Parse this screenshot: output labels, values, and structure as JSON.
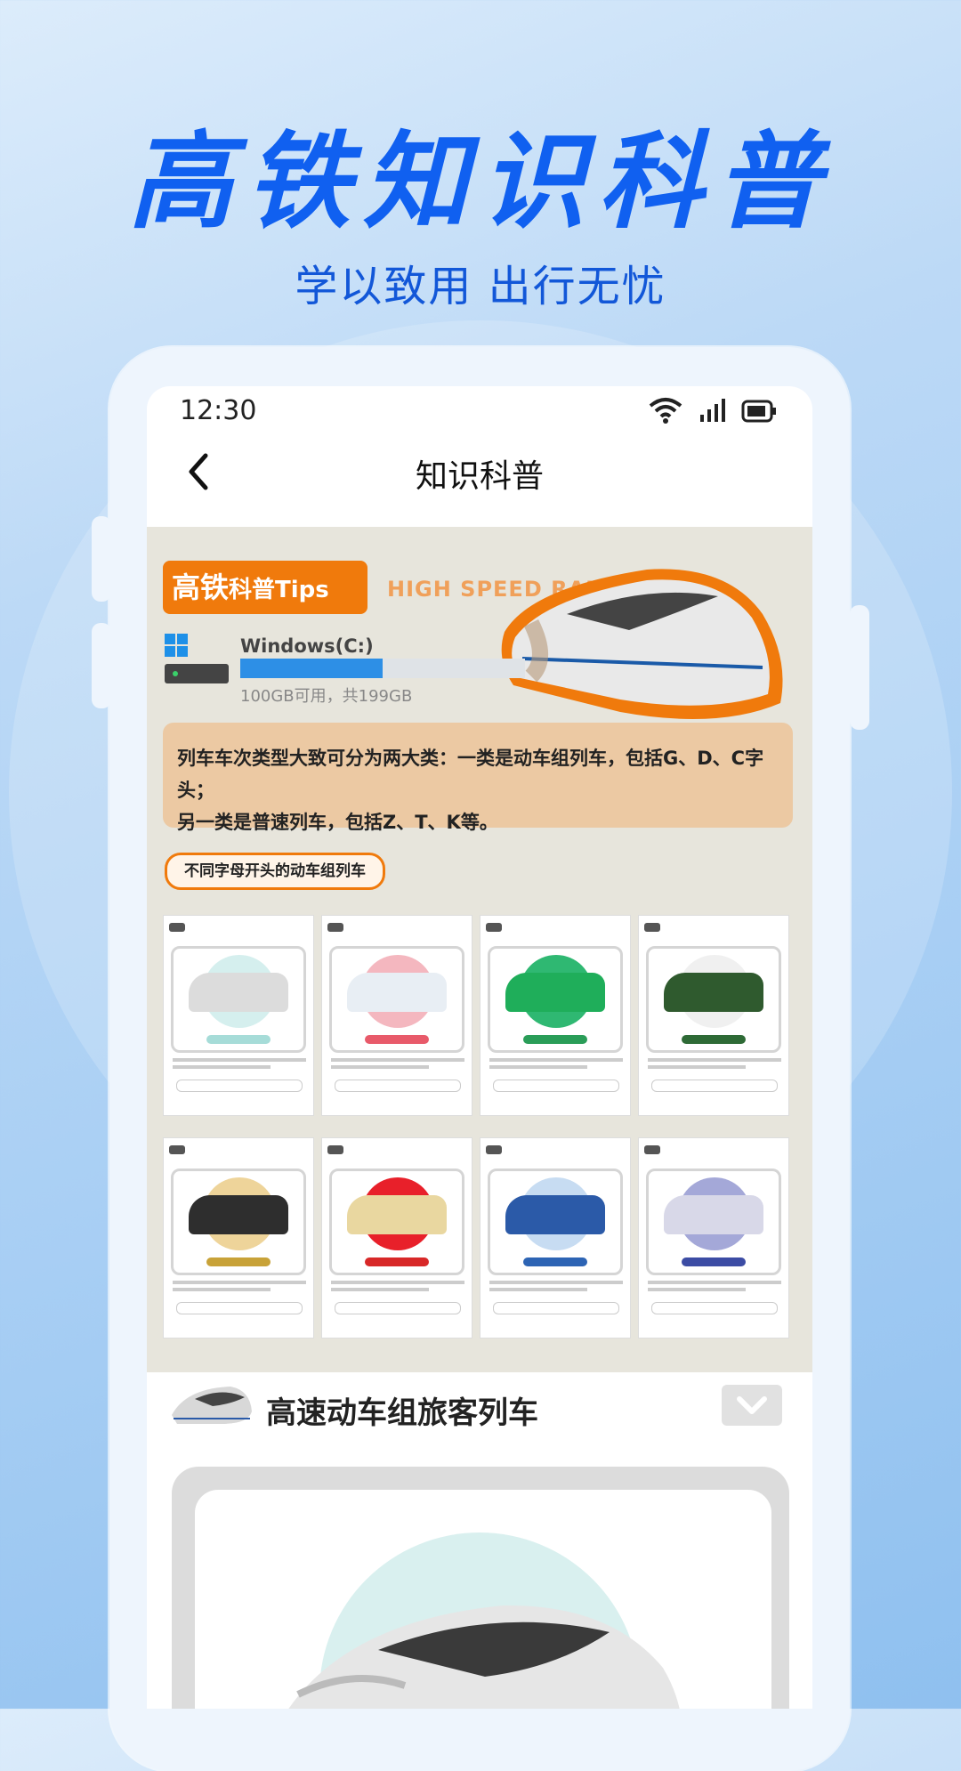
{
  "hero": {
    "title": "高铁知识科普",
    "subtitle": "学以致用 出行无忧"
  },
  "status_bar": {
    "time": "12:30",
    "icons": [
      "wifi-icon",
      "signal-icon",
      "battery-icon"
    ]
  },
  "nav": {
    "back_icon": "chevron-left-icon",
    "title": "知识科普"
  },
  "poster": {
    "tag": "高铁",
    "tag_suffix": "科普Tips",
    "header_en": "HIGH SPEED RAIL",
    "drive_label": "Windows(C:)",
    "drive_usage_fraction": 0.5,
    "drive_free": "100GB可用，共199GB",
    "info_line1": "列车车次类型大致可分为两大类：一类是动车组列车，包括G、D、C字头；",
    "info_line2": "另一类是普速列车，包括Z、T、K等。",
    "pill": "不同字母开头的动车组列车",
    "cards": [
      {
        "circle": "#d5efee",
        "train": "#dcdcdc",
        "label": "#a6dcd8"
      },
      {
        "circle": "#f4b7bf",
        "train": "#e8eef4",
        "label": "#e85a6a"
      },
      {
        "circle": "#2fb872",
        "train": "#1fae5a",
        "label": "#2a9d58"
      },
      {
        "circle": "#f0f0f0",
        "train": "#2f5a2e",
        "label": "#2e6a36"
      },
      {
        "circle": "#eed49a",
        "train": "#2e2e2e",
        "label": "#c8a238"
      },
      {
        "circle": "#e8202a",
        "train": "#e9d7a0",
        "label": "#d82828"
      },
      {
        "circle": "#c7dcf2",
        "train": "#2b5aa8",
        "label": "#2d64b4"
      },
      {
        "circle": "#a4a8d8",
        "train": "#d8d8e8",
        "label": "#3c4ca4"
      }
    ]
  },
  "section": {
    "title": "高速动车组旅客列车",
    "expand_icon": "chevron-down-icon"
  },
  "colors": {
    "brand_blue": "#1060f0",
    "orange": "#f07a0c"
  }
}
